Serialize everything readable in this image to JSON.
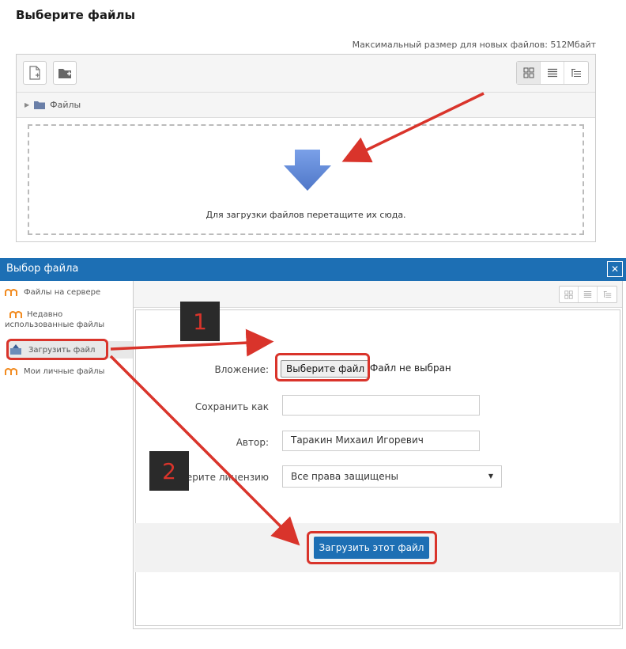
{
  "header": {
    "title": "Выберите файлы",
    "max_size": "Максимальный размер для новых файлов: 512Мбайт"
  },
  "file_manager": {
    "path_folder": "Файлы",
    "drop_text": "Для загрузки файлов перетащите их сюда."
  },
  "dialog": {
    "title": "Выбор файла",
    "close_glyph": "✕",
    "sidebar": [
      {
        "label": "Файлы на сервере"
      },
      {
        "label": "Недавно использованные файлы"
      },
      {
        "label": "Загрузить файл"
      },
      {
        "label": "Мои личные файлы"
      }
    ],
    "form": {
      "attachment_label": "Вложение:",
      "choose_button": "Выберите файл",
      "no_file": "Файл не выбран",
      "save_as_label": "Сохранить как",
      "save_as_value": "",
      "author_label": "Автор:",
      "author_value": "Таракин Михаил Игоревич",
      "license_label": "Выберите лицензию",
      "license_value": "Все права защищены",
      "upload_button": "Загрузить этот файл"
    }
  },
  "annotations": {
    "step1": "1",
    "step2": "2"
  },
  "colors": {
    "header_blue": "#1d6fb4",
    "annotation_red": "#d9342b",
    "drop_arrow_blue": "#5b86d6"
  }
}
